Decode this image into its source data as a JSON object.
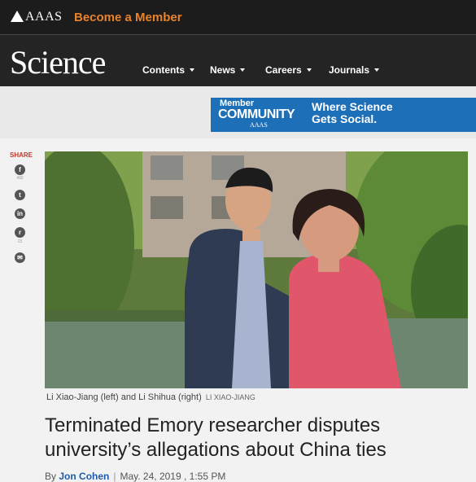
{
  "topbar": {
    "aaas_logo": "AAAS",
    "become_member": "Become a Member"
  },
  "nav": {
    "brand": "Science",
    "items": [
      {
        "label": "Contents"
      },
      {
        "label": "News"
      },
      {
        "label": "Careers"
      },
      {
        "label": "Journals"
      }
    ]
  },
  "ad": {
    "member": "Member",
    "community": "COMMUNITY",
    "aaas": "AAAS",
    "tagline_1": "Where Science",
    "tagline_2": "Gets Social."
  },
  "share": {
    "label": "SHARE",
    "buttons": [
      {
        "icon": "facebook-icon",
        "glyph": "f",
        "count": "492"
      },
      {
        "icon": "twitter-icon",
        "glyph": "t",
        "count": ""
      },
      {
        "icon": "linkedin-icon",
        "glyph": "in",
        "count": ""
      },
      {
        "icon": "reddit-icon",
        "glyph": "r",
        "count": "23"
      },
      {
        "icon": "email-icon",
        "glyph": "✉",
        "count": ""
      }
    ]
  },
  "article": {
    "caption": "Li Xiao-Jiang (left) and Li Shihua (right)",
    "credit": "LI XIAO-JIANG",
    "headline_line1": "Terminated Emory researcher disputes",
    "headline_line2": "university’s allegations about China ties",
    "byline_prefix": "By",
    "author": "Jon Cohen",
    "date": "May. 24, 2019 , 1:55 PM"
  },
  "colors": {
    "accent_orange": "#e8832a",
    "ad_blue": "#1d6fb8",
    "share_red": "#c0392b",
    "link_blue": "#1d5ca8"
  }
}
